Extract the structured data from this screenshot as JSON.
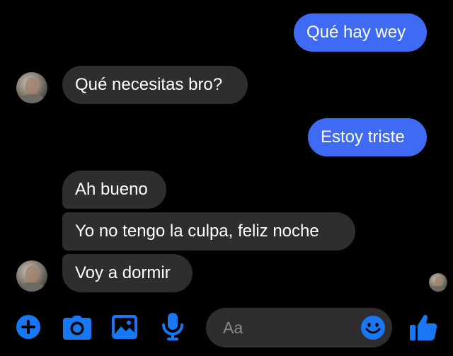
{
  "messages": [
    {
      "id": "m1",
      "direction": "outgoing",
      "text": "Qué hay wey"
    },
    {
      "id": "m2",
      "direction": "incoming",
      "text": "Qué necesitas bro?"
    },
    {
      "id": "m3",
      "direction": "outgoing",
      "text": "Estoy triste"
    },
    {
      "id": "m4",
      "direction": "incoming",
      "text": "Ah bueno"
    },
    {
      "id": "m5",
      "direction": "incoming",
      "text": "Yo no tengo la culpa, feliz noche"
    },
    {
      "id": "m6",
      "direction": "incoming",
      "text": "Voy a dormir"
    }
  ],
  "composer": {
    "placeholder": "Aa"
  },
  "toolbar": {
    "icons": [
      "plus-icon",
      "camera-icon",
      "gallery-icon",
      "microphone-icon",
      "emoji-icon",
      "thumbs-up-icon"
    ]
  },
  "colors": {
    "background": "#000000",
    "outgoing_bubble": "#3f6af3",
    "incoming_bubble": "#2e2e2e",
    "accent": "#1877f2",
    "input_background": "#2e2e2e"
  }
}
